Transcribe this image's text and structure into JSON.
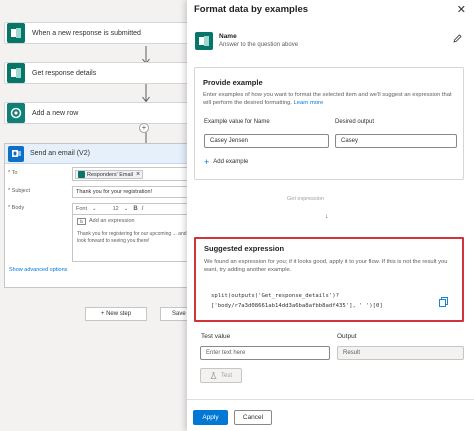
{
  "flow": {
    "steps": [
      {
        "label": "When a new response is submitted",
        "icon": "forms-icon"
      },
      {
        "label": "Get response details",
        "icon": "forms-icon"
      },
      {
        "label": "Add a new row",
        "icon": "dataverse-icon"
      }
    ],
    "email": {
      "title": "Send an email (V2)",
      "to_label": "* To",
      "to_token": "Responders' Email",
      "subject_label": "* Subject",
      "subject_value": "Thank you for your registration!",
      "body_label": "* Body",
      "font_label": "Font",
      "font_size": "12",
      "add_expression": "Add an expression",
      "body_text": "Thank you for registering for our upcoming ... and look forward to seeing you there!",
      "advanced_options": "Show advanced options"
    },
    "new_step": "+ New step",
    "save": "Save"
  },
  "panel": {
    "title": "Format data by examples",
    "field_name": "Name",
    "field_desc": "Answer to the question above",
    "provide_example": {
      "title": "Provide example",
      "description": "Enter examples of how you want to format the selected item and we'll suggest an expression that will perform the desired formatting.",
      "learn_more": "Learn more",
      "col_example": "Example value for Name",
      "col_output": "Desired output",
      "example_value": "Casey Jensen",
      "output_value": "Casey",
      "add_example": "Add example"
    },
    "get_expression": "Get expression",
    "suggested": {
      "title": "Suggested expression",
      "description": "We found an expression for you; if it looks good, apply it to your flow. If this is not the result you want, try adding another example.",
      "code_line1": "split(outputs('Get_response_details')?",
      "code_line2": "['body/r7a3d08661ab14dd3a6ba8afbb8adf435'], ' ')[0]"
    },
    "test": {
      "test_value_label": "Test value",
      "output_label": "Output",
      "input_placeholder": "Enter text here",
      "result_placeholder": "Result",
      "test_button": "Test"
    },
    "apply": "Apply",
    "cancel": "Cancel"
  },
  "colors": {
    "accent": "#0078d4",
    "forms": "#077568",
    "highlight_border": "#d13438"
  }
}
